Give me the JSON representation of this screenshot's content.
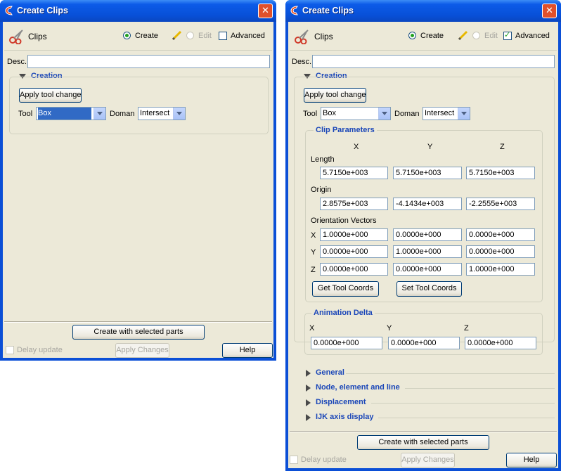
{
  "left": {
    "title": "Create Clips",
    "header": {
      "label": "Clips",
      "create": "Create",
      "edit": "Edit",
      "advanced": "Advanced",
      "advanced_checked": false
    },
    "desc_label": "Desc.",
    "desc_value": "",
    "creation": {
      "heading": "Creation",
      "apply_button": "Apply tool change",
      "tool_label": "Tool",
      "tool_value": "Box",
      "domain_label": "Doman",
      "domain_value": "Intersect"
    },
    "footer": {
      "create_button": "Create with selected parts",
      "delay_update": "Delay update",
      "apply_changes": "Apply Changes",
      "help": "Help"
    }
  },
  "right": {
    "title": "Create Clips",
    "header": {
      "label": "Clips",
      "create": "Create",
      "edit": "Edit",
      "advanced": "Advanced",
      "advanced_checked": true
    },
    "desc_label": "Desc.",
    "desc_value": "",
    "creation": {
      "heading": "Creation",
      "apply_button": "Apply tool change",
      "tool_label": "Tool",
      "tool_value": "Box",
      "domain_label": "Doman",
      "domain_value": "Intersect"
    },
    "clip_params": {
      "heading": "Clip Parameters",
      "col_x": "X",
      "col_y": "Y",
      "col_z": "Z",
      "length_label": "Length",
      "length": [
        "5.7150e+003",
        "5.7150e+003",
        "5.7150e+003"
      ],
      "origin_label": "Origin",
      "origin": [
        "2.8575e+003",
        "-4.1434e+003",
        "-2.2555e+003"
      ],
      "orient_label": "Orientation Vectors",
      "row_x": "X",
      "orient_x": [
        "1.0000e+000",
        "0.0000e+000",
        "0.0000e+000"
      ],
      "row_y": "Y",
      "orient_y": [
        "0.0000e+000",
        "1.0000e+000",
        "0.0000e+000"
      ],
      "row_z": "Z",
      "orient_z": [
        "0.0000e+000",
        "0.0000e+000",
        "1.0000e+000"
      ],
      "get_button": "Get Tool Coords",
      "set_button": "Set Tool Coords"
    },
    "anim_delta": {
      "heading": "Animation Delta",
      "col_x": "X",
      "col_y": "Y",
      "col_z": "Z",
      "values": [
        "0.0000e+000",
        "0.0000e+000",
        "0.0000e+000"
      ]
    },
    "sections": [
      "General",
      "Node, element and line",
      "Displacement",
      "IJK axis display"
    ],
    "footer": {
      "create_button": "Create with selected parts",
      "delay_update": "Delay update",
      "apply_changes": "Apply Changes",
      "help": "Help"
    }
  }
}
